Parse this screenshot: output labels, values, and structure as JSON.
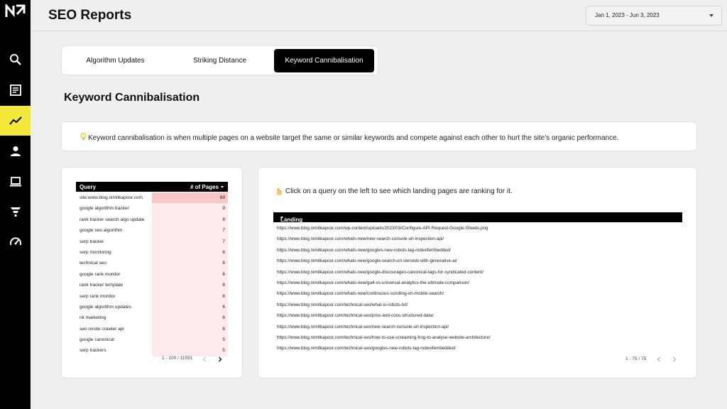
{
  "sidebar": {
    "logo": "N\\",
    "items": [
      {
        "name": "search",
        "icon": "search-icon",
        "active": false
      },
      {
        "name": "reports",
        "icon": "document-icon",
        "active": false
      },
      {
        "name": "trends",
        "icon": "trend-chart-icon",
        "active": true
      },
      {
        "name": "account",
        "icon": "user-icon",
        "active": false
      },
      {
        "name": "devices",
        "icon": "laptop-icon",
        "active": false
      },
      {
        "name": "funnel",
        "icon": "funnel-icon",
        "active": false
      },
      {
        "name": "performance",
        "icon": "speedometer-icon",
        "active": false
      }
    ],
    "accent_color": "#f3e93d"
  },
  "header": {
    "title": "SEO Reports",
    "date_range": "Jan 1, 2023 - Jun 3, 2023"
  },
  "tabs": [
    {
      "label": "Algorithm Updates",
      "active": false
    },
    {
      "label": "Striking Distance",
      "active": false
    },
    {
      "label": "Keyword Cannibalisation",
      "active": true
    }
  ],
  "section_title": "Keyword Cannibalisation",
  "info": {
    "icon": "lightbulb-icon",
    "text": "Keyword cannibalisation is when multiple pages on a website target the same or similar keywords and compete against each other to hurt the site’s organic performance."
  },
  "query_table": {
    "columns": [
      "Query",
      "# of Pages"
    ],
    "rows": [
      {
        "query": "site:www.blog.nimitkapoor.com",
        "pages": 69
      },
      {
        "query": "google algorithm tracker",
        "pages": 9
      },
      {
        "query": "rank tracker search algo update",
        "pages": 8
      },
      {
        "query": "google seo algorithm",
        "pages": 7
      },
      {
        "query": "serp tracker",
        "pages": 7
      },
      {
        "query": "serp monitoring",
        "pages": 6
      },
      {
        "query": "technical seo",
        "pages": 6
      },
      {
        "query": "google rank monitor",
        "pages": 6
      },
      {
        "query": "rank tracker template",
        "pages": 6
      },
      {
        "query": "serp rank monitor",
        "pages": 6
      },
      {
        "query": "google algorithm updates",
        "pages": 6
      },
      {
        "query": "nk marketing",
        "pages": 6
      },
      {
        "query": "seo onsite crawler api",
        "pages": 6
      },
      {
        "query": "google canonical",
        "pages": 5
      },
      {
        "query": "serp trackers",
        "pages": 5
      }
    ],
    "pagination": "1 - 100 / 11591"
  },
  "landing_panel": {
    "hint": "Click on a query on the left to see which landing pages are ranking for it.",
    "hint_icon": "pointing-hand-icon",
    "column": "Landing Page",
    "rows": [
      "https://www.blog.nimitkapoor.com/wp-content/uploads/2023/03/Configure-API-Request-Google-Sheets.png",
      "https://www.blog.nimitkapoor.com/whats-new/new-search-console-url-inspection-api/",
      "https://www.blog.nimitkapoor.com/whats-new/googles-new-robots-tag-indexifembedded/",
      "https://www.blog.nimitkapoor.com/whats-new/google-search-on-steroids-with-generative-ai/",
      "https://www.blog.nimitkapoor.com/whats-new/google-discourages-canonical-tags-for-syndicated-content/",
      "https://www.blog.nimitkapoor.com/whats-new/ga4-vs-universal-analytics-the-ultimate-comparison/",
      "https://www.blog.nimitkapoor.com/whats-new/continuous-scrolling-on-mobile-search/",
      "https://www.blog.nimitkapoor.com/technical-seo/what-is-robots-txt/",
      "https://www.blog.nimitkapoor.com/technical-seo/pros-and-cons-structured-data/",
      "https://www.blog.nimitkapoor.com/technical-seo/new-search-console-url-inspection-api/",
      "https://www.blog.nimitkapoor.com/technical-seo/how-to-use-screaming-frog-to-analyse-website-architecture/",
      "https://www.blog.nimitkapoor.com/technical-seo/googles-new-robots-tag-indexifembedded/"
    ],
    "pagination": "1 - 75 / 75"
  }
}
